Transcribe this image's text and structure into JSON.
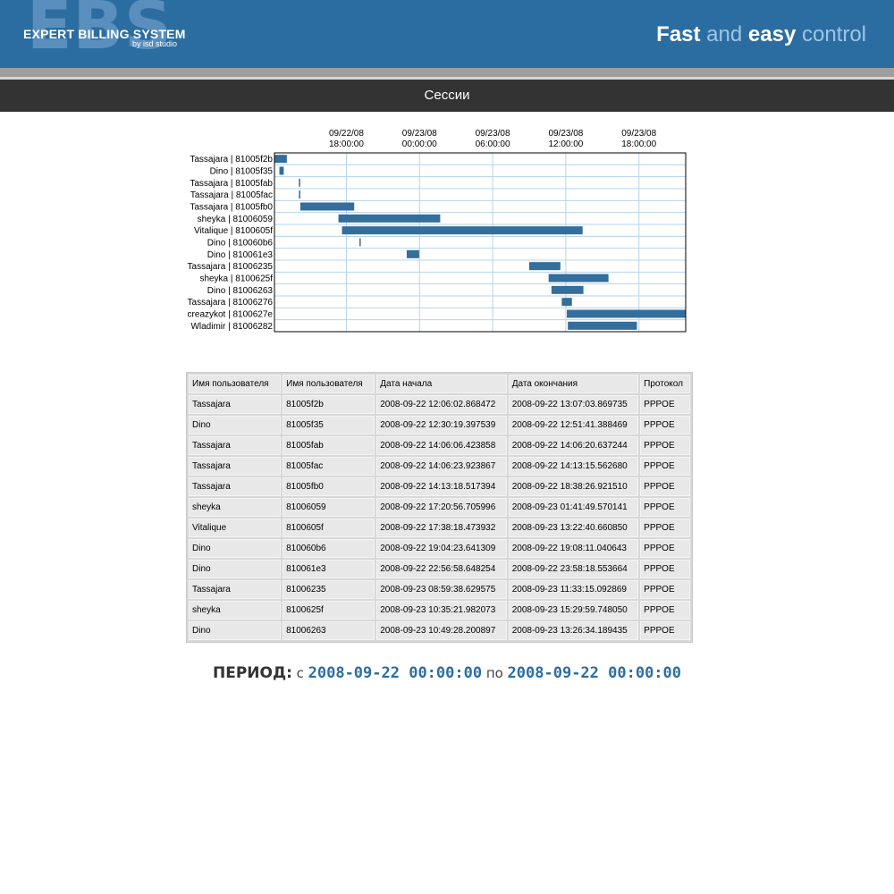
{
  "header": {
    "logo_big": "EBS",
    "logo_title": "EXPERT BILLING SYSTEM",
    "logo_sub": "by isd studio",
    "tagline_fast": "Fast",
    "tagline_and": " and ",
    "tagline_easy": "easy",
    "tagline_control": " control"
  },
  "nav": {
    "title": "Сессии"
  },
  "colors": {
    "header_bg": "#2c6da1",
    "nav_bg": "#333333",
    "bar": "#336e9c",
    "grid": "#b8d3e8",
    "accent": "#2c6da1"
  },
  "chart_data": {
    "type": "gantt",
    "x_ticks": [
      {
        "date": "09/22/08",
        "time": "18:00:00",
        "t": "2008-09-22 18:00:00"
      },
      {
        "date": "09/23/08",
        "time": "00:00:00",
        "t": "2008-09-23 00:00:00"
      },
      {
        "date": "09/23/08",
        "time": "06:00:00",
        "t": "2008-09-23 06:00:00"
      },
      {
        "date": "09/23/08",
        "time": "12:00:00",
        "t": "2008-09-23 12:00:00"
      },
      {
        "date": "09/23/08",
        "time": "18:00:00",
        "t": "2008-09-23 18:00:00"
      }
    ],
    "xlim": [
      "2008-09-22 12:06:00",
      "2008-09-23 21:50:00"
    ],
    "tasks": [
      {
        "label": "Tassajara | 81005f2b",
        "start": "2008-09-22 12:06:02",
        "end": "2008-09-22 13:07:03"
      },
      {
        "label": "Dino | 81005f35",
        "start": "2008-09-22 12:30:19",
        "end": "2008-09-22 12:51:41"
      },
      {
        "label": "Tassajara | 81005fab",
        "start": "2008-09-22 14:06:06",
        "end": "2008-09-22 14:06:20"
      },
      {
        "label": "Tassajara | 81005fac",
        "start": "2008-09-22 14:06:23",
        "end": "2008-09-22 14:13:15"
      },
      {
        "label": "Tassajara | 81005fb0",
        "start": "2008-09-22 14:13:18",
        "end": "2008-09-22 18:38:26"
      },
      {
        "label": "sheyka | 81006059",
        "start": "2008-09-22 17:20:56",
        "end": "2008-09-23 01:41:49"
      },
      {
        "label": "Vitalique | 8100605f",
        "start": "2008-09-22 17:38:18",
        "end": "2008-09-23 13:22:40"
      },
      {
        "label": "Dino | 810060b6",
        "start": "2008-09-22 19:04:23",
        "end": "2008-09-22 19:08:11"
      },
      {
        "label": "Dino | 810061e3",
        "start": "2008-09-22 22:56:58",
        "end": "2008-09-22 23:58:18"
      },
      {
        "label": "Tassajara | 81006235",
        "start": "2008-09-23 08:59:38",
        "end": "2008-09-23 11:33:15"
      },
      {
        "label": "sheyka | 8100625f",
        "start": "2008-09-23 10:35:21",
        "end": "2008-09-23 15:29:59"
      },
      {
        "label": "Dino | 81006263",
        "start": "2008-09-23 10:49:28",
        "end": "2008-09-23 13:26:34"
      },
      {
        "label": "Tassajara | 81006276",
        "start": "2008-09-23 11:40:00",
        "end": "2008-09-23 12:30:00"
      },
      {
        "label": "creazykot | 8100627e",
        "start": "2008-09-23 12:05:00",
        "end": "2008-09-23 21:50:00"
      },
      {
        "label": "Wladimir | 81006282",
        "start": "2008-09-23 12:10:00",
        "end": "2008-09-23 17:50:00"
      }
    ]
  },
  "table": {
    "headers": [
      "Имя пользователя",
      "Имя пользователя",
      "Дата начала",
      "Дата окончания",
      "Протокол"
    ],
    "rows": [
      [
        "Tassajara",
        "81005f2b",
        "2008-09-22 12:06:02.868472",
        "2008-09-22 13:07:03.869735",
        "PPPOE"
      ],
      [
        "Dino",
        "81005f35",
        "2008-09-22 12:30:19.397539",
        "2008-09-22 12:51:41.388469",
        "PPPOE"
      ],
      [
        "Tassajara",
        "81005fab",
        "2008-09-22 14:06:06.423858",
        "2008-09-22 14:06:20.637244",
        "PPPOE"
      ],
      [
        "Tassajara",
        "81005fac",
        "2008-09-22 14:06:23.923867",
        "2008-09-22 14:13:15.562680",
        "PPPOE"
      ],
      [
        "Tassajara",
        "81005fb0",
        "2008-09-22 14:13:18.517394",
        "2008-09-22 18:38:26.921510",
        "PPPOE"
      ],
      [
        "sheyka",
        "81006059",
        "2008-09-22 17:20:56.705996",
        "2008-09-23 01:41:49.570141",
        "PPPOE"
      ],
      [
        "Vitalique",
        "8100605f",
        "2008-09-22 17:38:18.473932",
        "2008-09-23 13:22:40.660850",
        "PPPOE"
      ],
      [
        "Dino",
        "810060b6",
        "2008-09-22 19:04:23.641309",
        "2008-09-22 19:08:11.040643",
        "PPPOE"
      ],
      [
        "Dino",
        "810061e3",
        "2008-09-22 22:56:58.648254",
        "2008-09-22 23:58:18.553664",
        "PPPOE"
      ],
      [
        "Tassajara",
        "81006235",
        "2008-09-23 08:59:38.629575",
        "2008-09-23 11:33:15.092869",
        "PPPOE"
      ],
      [
        "sheyka",
        "8100625f",
        "2008-09-23 10:35:21.982073",
        "2008-09-23 15:29:59.748050",
        "PPPOE"
      ],
      [
        "Dino",
        "81006263",
        "2008-09-23 10:49:28.200897",
        "2008-09-23 13:26:34.189435",
        "PPPOE"
      ]
    ]
  },
  "period": {
    "label": "ПЕРИОД:",
    "from_word": "с",
    "from": "2008-09-22 00:00:00",
    "to_word": "по",
    "to": "2008-09-22 00:00:00"
  }
}
